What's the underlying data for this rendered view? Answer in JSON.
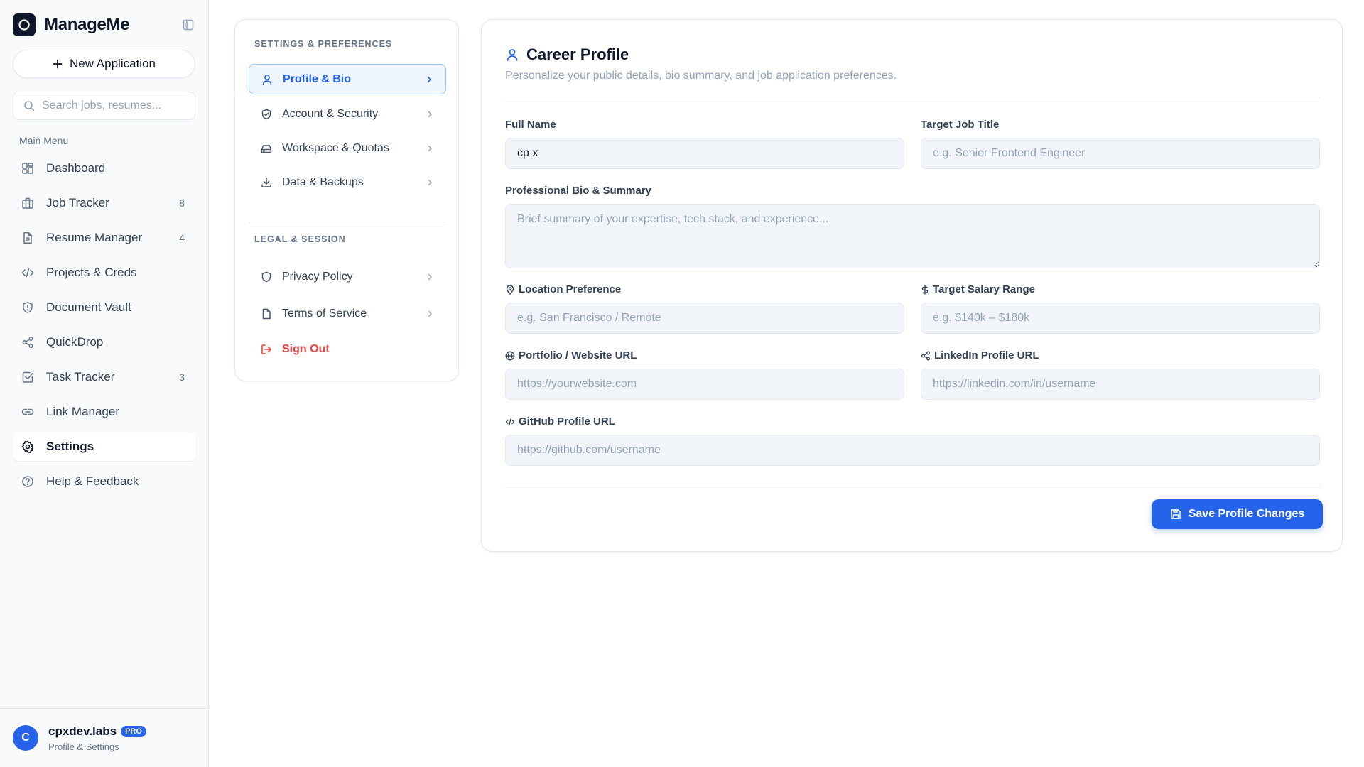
{
  "app": {
    "name": "ManageMe"
  },
  "sidebar": {
    "new_button_label": "New Application",
    "search_placeholder": "Search jobs, resumes...",
    "menu_label": "Main Menu",
    "items": [
      {
        "label": "Dashboard",
        "icon": "dashboard-icon",
        "badge": ""
      },
      {
        "label": "Job Tracker",
        "icon": "briefcase-icon",
        "badge": "8"
      },
      {
        "label": "Resume Manager",
        "icon": "file-text-icon",
        "badge": "4"
      },
      {
        "label": "Projects & Creds",
        "icon": "code-icon",
        "badge": ""
      },
      {
        "label": "Document Vault",
        "icon": "shield-icon",
        "badge": ""
      },
      {
        "label": "QuickDrop",
        "icon": "share-icon",
        "badge": ""
      },
      {
        "label": "Task Tracker",
        "icon": "check-square-icon",
        "badge": "3"
      },
      {
        "label": "Link Manager",
        "icon": "link-icon",
        "badge": ""
      },
      {
        "label": "Settings",
        "icon": "gear-icon",
        "badge": "",
        "active": true
      },
      {
        "label": "Help & Feedback",
        "icon": "help-circle-icon",
        "badge": ""
      }
    ],
    "user": {
      "initial": "C",
      "name": "cpxdev.labs",
      "badge": "PRO",
      "subtitle": "Profile & Settings"
    }
  },
  "settings_nav": {
    "section1_title": "SETTINGS & PREFERENCES",
    "section1_items": [
      {
        "label": "Profile & Bio",
        "icon": "user-icon",
        "active": true
      },
      {
        "label": "Account & Security",
        "icon": "shield-check-icon"
      },
      {
        "label": "Workspace & Quotas",
        "icon": "hard-drive-icon"
      },
      {
        "label": "Data & Backups",
        "icon": "download-icon"
      }
    ],
    "section2_title": "LEGAL & SESSION",
    "section2_items": [
      {
        "label": "Privacy Policy",
        "icon": "shield-icon"
      },
      {
        "label": "Terms of Service",
        "icon": "file-icon"
      },
      {
        "label": "Sign Out",
        "icon": "logout-icon"
      }
    ]
  },
  "profile": {
    "title": "Career Profile",
    "subtitle": "Personalize your public details, bio summary, and job application preferences.",
    "fields": {
      "full_name": {
        "label": "Full Name",
        "value": "cp x",
        "placeholder": ""
      },
      "job_title": {
        "label": "Target Job Title",
        "value": "",
        "placeholder": "e.g. Senior Frontend Engineer"
      },
      "bio": {
        "label": "Professional Bio & Summary",
        "value": "",
        "placeholder": "Brief summary of your expertise, tech stack, and experience..."
      },
      "location": {
        "label": "Location Preference",
        "value": "",
        "placeholder": "e.g. San Francisco / Remote"
      },
      "salary": {
        "label": "Target Salary Range",
        "value": "",
        "placeholder": "e.g. $140k – $180k"
      },
      "portfolio": {
        "label": "Portfolio / Website URL",
        "value": "",
        "placeholder": "https://yourwebsite.com"
      },
      "linkedin": {
        "label": "LinkedIn Profile URL",
        "value": "",
        "placeholder": "https://linkedin.com/in/username"
      },
      "github": {
        "label": "GitHub Profile URL",
        "value": "",
        "placeholder": "https://github.com/username"
      }
    },
    "save_label": "Save Profile Changes"
  },
  "colors": {
    "accent": "#2563eb",
    "danger": "#ef4444",
    "sidebar_bg": "#f8fafc",
    "input_bg": "#f1f5f9"
  }
}
